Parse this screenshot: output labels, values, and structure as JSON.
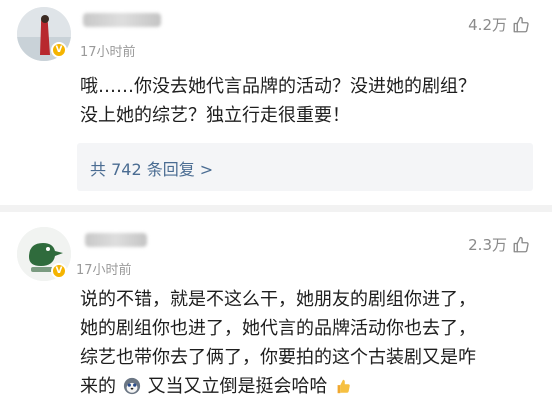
{
  "comments": [
    {
      "timestamp": "17小时前",
      "likes": "4.2万",
      "text_lines": [
        "哦……你没去她代言品牌的活动？没进她的剧组？",
        "没上她的综艺？独立行走很重要！"
      ],
      "replies_link": "共 742 条回复 >",
      "icons": {
        "like": "thumbs-up-icon",
        "verified": "verified-badge-icon"
      }
    },
    {
      "timestamp": "17小时前",
      "likes": "2.3万",
      "text_lines": [
        "说的不错，就是不这么干，她朋友的剧组你进了，",
        "她的剧组你也进了，她代言的品牌活动你也去了，",
        "综艺也带你去了俩了，你要拍的这个古装剧又是咋",
        "来的",
        "又当又立倒是挺会哈哈"
      ],
      "icons": {
        "like": "thumbs-up-icon",
        "verified": "verified-badge-icon",
        "emoji_1": "husky-emoji-icon",
        "emoji_2": "thumbs-up-emoji-icon"
      }
    }
  ],
  "colors": {
    "link": "#4a6c92",
    "badge": "#f5b400",
    "meta": "#9a9a9a",
    "replies_bg": "#f4f5f7"
  }
}
